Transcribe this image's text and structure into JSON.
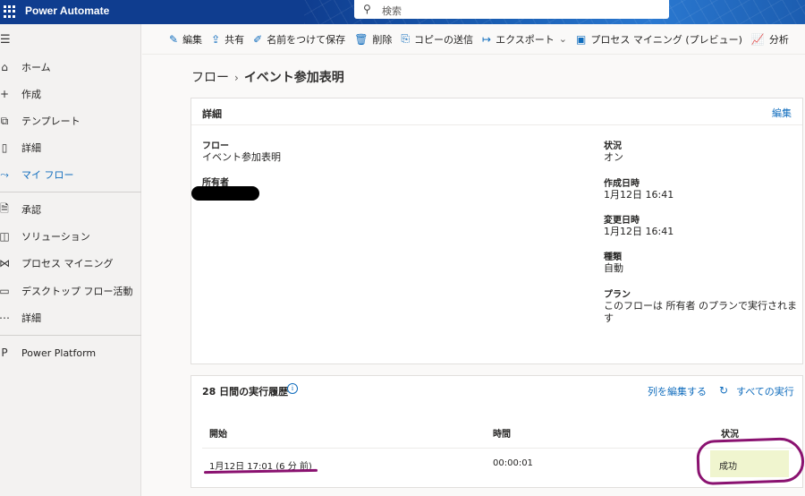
{
  "topbar": {
    "app_title": "Power Automate",
    "search_placeholder": "検索"
  },
  "sidebar": {
    "items": [
      {
        "label": "ホーム",
        "icon": "home-icon"
      },
      {
        "label": "作成",
        "icon": "plus-icon"
      },
      {
        "label": "テンプレート",
        "icon": "template-icon"
      },
      {
        "label": "詳細",
        "icon": "book-icon"
      },
      {
        "label": "マイ フロー",
        "icon": "flow-icon",
        "active": true
      },
      {
        "label": "承認",
        "icon": "approval-icon"
      },
      {
        "label": "ソリューション",
        "icon": "solution-icon"
      },
      {
        "label": "プロセス マイニング",
        "icon": "process-mining-icon"
      },
      {
        "label": "デスクトップ フロー活動",
        "icon": "desktop-flow-icon"
      },
      {
        "label": "詳細",
        "icon": "more-icon"
      },
      {
        "label": "Power Platform",
        "icon": "power-platform-icon"
      }
    ]
  },
  "cmdbar": {
    "edit": "編集",
    "share": "共有",
    "save_as": "名前をつけて保存",
    "delete": "削除",
    "send_copy": "コピーの送信",
    "export": "エクスポート",
    "process_mining": "プロセス マイニング (プレビュー)",
    "analytics": "分析"
  },
  "breadcrumb": {
    "root": "フロー",
    "current": "イベント参加表明"
  },
  "details": {
    "title": "詳細",
    "edit_link": "編集",
    "flow_label": "フロー",
    "flow_value": "イベント参加表明",
    "owner_label": "所有者",
    "status_label": "状況",
    "status_value": "オン",
    "created_label": "作成日時",
    "created_value": "1月12日 16:41",
    "modified_label": "変更日時",
    "modified_value": "1月12日 16:41",
    "type_label": "種類",
    "type_value": "自動",
    "plan_label": "プラン",
    "plan_value_line1": "このフローは 所有者 のプランで実行されま",
    "plan_value_line2": "す"
  },
  "history": {
    "title": "28 日間の実行履歴",
    "edit_columns": "列を編集する",
    "all_runs": "すべての実行",
    "columns": {
      "start": "開始",
      "duration": "時間",
      "status": "状況"
    },
    "rows": [
      {
        "start": "1月12日 17:01 (6 分 前)",
        "duration": "00:00:01",
        "status": "成功"
      }
    ]
  },
  "colors": {
    "topbar": "#0f3d8f",
    "accent": "#0f6cbd",
    "annotation": "#8a1270",
    "success_highlight": "#f0f5cf"
  }
}
